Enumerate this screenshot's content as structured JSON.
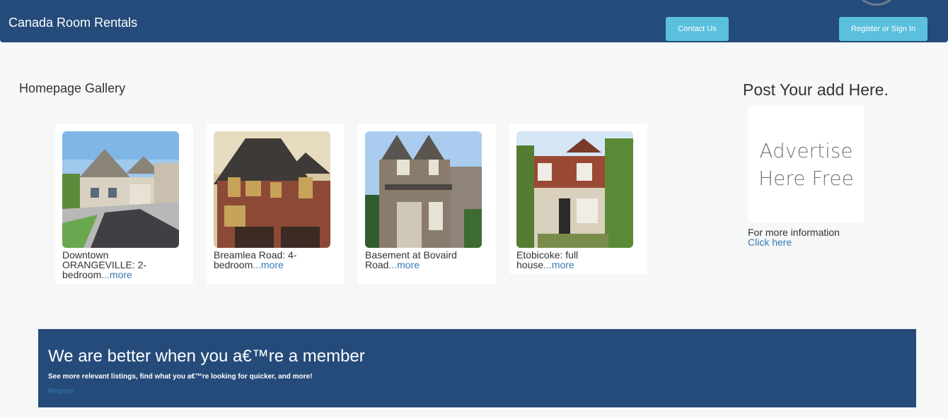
{
  "header": {
    "title": "Canada Room Rentals",
    "contact_label": "Contact Us",
    "register_label": "Register or Sign In"
  },
  "gallery": {
    "title": "Homepage Gallery",
    "items": [
      {
        "caption": "Downtown ORANGEVILLE: 2-bedroom",
        "more": "...more"
      },
      {
        "caption": "Breamlea Road: 4-bedroom",
        "more": "...more"
      },
      {
        "caption": "Basement at Bovaird Road",
        "more": "...more"
      },
      {
        "caption": "Etobicoke: full house",
        "more": "...more"
      }
    ]
  },
  "ad": {
    "heading": "Post Your add Here.",
    "box_line1": "Advertise",
    "box_line2": "Here Free",
    "info": "For more information",
    "link": "Click here"
  },
  "member": {
    "title": "We are better when you a€™re a member",
    "subtitle": "See more relevant listings, find what you a€™re looking for quicker, and more!",
    "link": "Register"
  }
}
